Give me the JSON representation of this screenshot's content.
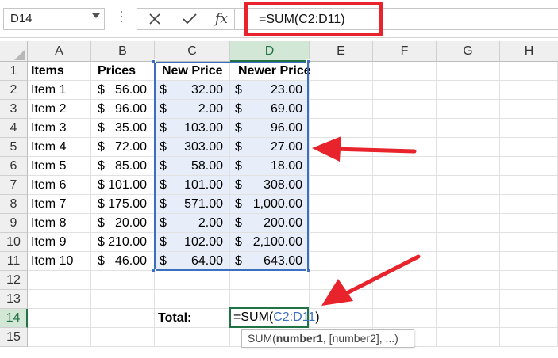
{
  "name_box": {
    "value": "D14"
  },
  "formula_bar": {
    "cancel_icon": "close-icon",
    "enter_icon": "checkmark-icon",
    "fx_label": "fx",
    "formula": "=SUM(C2:D11)"
  },
  "columns": [
    "A",
    "B",
    "C",
    "D",
    "E",
    "F",
    "G",
    "H"
  ],
  "rows": [
    "1",
    "2",
    "3",
    "4",
    "5",
    "6",
    "7",
    "8",
    "9",
    "10",
    "11",
    "12",
    "13",
    "14",
    "15"
  ],
  "headers": {
    "items": "Items",
    "prices": "Prices",
    "new_price": "New Price",
    "newer_price": "Newer Price"
  },
  "table": [
    {
      "item": "Item 1",
      "price": "56.00",
      "new_price": "32.00",
      "newer_price": "23.00"
    },
    {
      "item": "Item 2",
      "price": "96.00",
      "new_price": "2.00",
      "newer_price": "69.00"
    },
    {
      "item": "Item 3",
      "price": "35.00",
      "new_price": "103.00",
      "newer_price": "96.00"
    },
    {
      "item": "Item 4",
      "price": "72.00",
      "new_price": "303.00",
      "newer_price": "27.00"
    },
    {
      "item": "Item 5",
      "price": "85.00",
      "new_price": "58.00",
      "newer_price": "18.00"
    },
    {
      "item": "Item 6",
      "price": "101.00",
      "new_price": "101.00",
      "newer_price": "308.00"
    },
    {
      "item": "Item 7",
      "price": "175.00",
      "new_price": "571.00",
      "newer_price": "1,000.00"
    },
    {
      "item": "Item 8",
      "price": "20.00",
      "new_price": "2.00",
      "newer_price": "200.00"
    },
    {
      "item": "Item 9",
      "price": "210.00",
      "new_price": "102.00",
      "newer_price": "2,100.00"
    },
    {
      "item": "Item 10",
      "price": "46.00",
      "new_price": "64.00",
      "newer_price": "643.00"
    }
  ],
  "currency_symbol": "$",
  "total_label": "Total:",
  "active_cell_formula": {
    "prefix": "=SUM(",
    "range": "C2:D11",
    "suffix": ")"
  },
  "tooltip": {
    "func": "SUM(",
    "arg1": "number1",
    "rest": ", [number2], ...)"
  },
  "colors": {
    "highlight_red": "#e8232b",
    "range_blue": "#3c6fbe",
    "excel_green": "#217346",
    "arrow_red": "#e8232b"
  }
}
